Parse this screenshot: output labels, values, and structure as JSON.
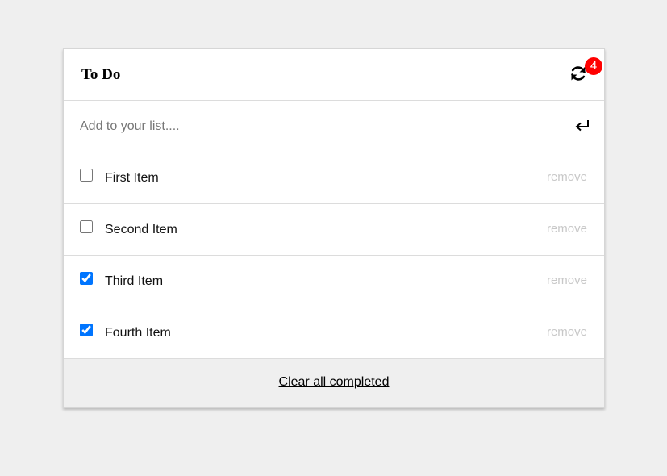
{
  "header": {
    "title": "To Do",
    "badge_count": "4"
  },
  "add": {
    "placeholder": "Add to your list...."
  },
  "items": [
    {
      "label": "First Item",
      "checked": false,
      "remove_label": "remove"
    },
    {
      "label": "Second Item",
      "checked": false,
      "remove_label": "remove"
    },
    {
      "label": "Third Item",
      "checked": true,
      "remove_label": "remove"
    },
    {
      "label": "Fourth Item",
      "checked": true,
      "remove_label": "remove"
    }
  ],
  "footer": {
    "clear_label": "Clear all completed"
  },
  "colors": {
    "badge": "#ff0000",
    "checkbox_accent": "#0075ff",
    "remove_text": "#c8c8c8",
    "footer_bg": "#efefef"
  },
  "icons": {
    "sync": "sync-icon",
    "enter": "enter-icon"
  }
}
